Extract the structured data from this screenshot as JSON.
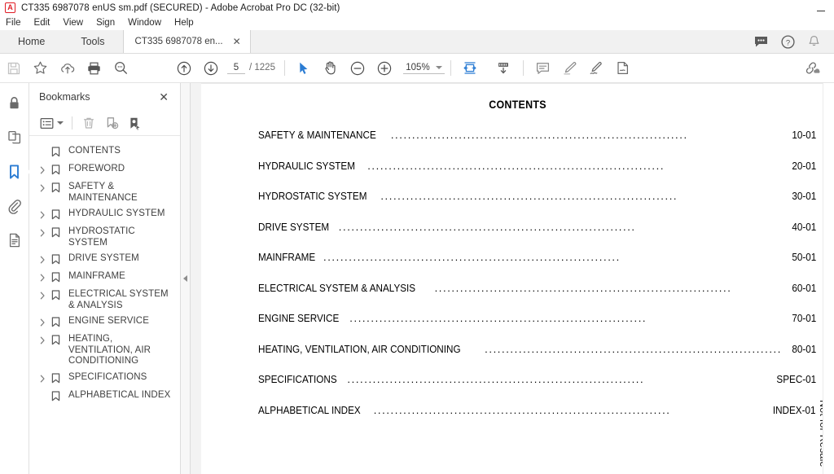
{
  "window": {
    "title": "CT335 6987078 enUS sm.pdf (SECURED) - Adobe Acrobat Pro DC (32-bit)",
    "app_icon": "acrobat-icon",
    "minimize_label": "—"
  },
  "menubar": {
    "items": [
      "File",
      "Edit",
      "View",
      "Sign",
      "Window",
      "Help"
    ]
  },
  "tabbar": {
    "home": "Home",
    "tools": "Tools",
    "document_tab": "CT335 6987078 en...",
    "close_glyph": "✕",
    "right_icons": [
      "comment-bubble-icon",
      "help-circle-icon",
      "bell-icon"
    ]
  },
  "toolbar": {
    "left_icons": [
      "save-icon",
      "star-icon",
      "cloud-upload-icon",
      "print-icon",
      "search-icon"
    ],
    "prev_page_icon": "arrow-up-circle-icon",
    "next_page_icon": "arrow-down-circle-icon",
    "page_number": "5",
    "page_count": "/ 1225",
    "select_tool_icon": "cursor-arrow-icon",
    "hand_tool_icon": "hand-icon",
    "zoom_out_icon": "minus-circle-icon",
    "zoom_in_icon": "plus-circle-icon",
    "zoom_level": "105%",
    "fit_width_icon": "fit-width-icon",
    "page_fit_icon": "scroll-down-icon",
    "comment_icon": "comment-icon",
    "highlight_icon": "highlight-pen-icon",
    "sign_icon": "sign-icon",
    "fill_sign_icon": "fill-and-sign-icon",
    "share_icon": "share-cloud-icon"
  },
  "rail": {
    "items": [
      {
        "name": "security-lock-icon",
        "active": false
      },
      {
        "name": "page-thumbnails-icon",
        "active": false
      },
      {
        "name": "bookmarks-icon",
        "active": true
      },
      {
        "name": "attachments-icon",
        "active": false
      },
      {
        "name": "layers-icon",
        "active": false
      }
    ]
  },
  "bookmarks_panel": {
    "title": "Bookmarks",
    "close_glyph": "✕",
    "tools": [
      "options-list-icon",
      "delete-bookmark-icon",
      "new-bookmark-icon",
      "bookmark-properties-icon"
    ],
    "items": [
      {
        "label": "CONTENTS",
        "expandable": false
      },
      {
        "label": "FOREWORD",
        "expandable": true
      },
      {
        "label": "SAFETY & MAINTENANCE",
        "expandable": true
      },
      {
        "label": "HYDRAULIC SYSTEM",
        "expandable": true
      },
      {
        "label": "HYDROSTATIC SYSTEM",
        "expandable": true
      },
      {
        "label": "DRIVE SYSTEM",
        "expandable": true
      },
      {
        "label": "MAINFRAME",
        "expandable": true
      },
      {
        "label": "ELECTRICAL SYSTEM & ANALYSIS",
        "expandable": true
      },
      {
        "label": "ENGINE SERVICE",
        "expandable": true
      },
      {
        "label": "HEATING, VENTILATION, AIR CONDITIONING",
        "expandable": true
      },
      {
        "label": "SPECIFICATIONS",
        "expandable": true
      },
      {
        "label": "ALPHABETICAL INDEX",
        "expandable": false
      }
    ]
  },
  "document": {
    "heading": "CONTENTS",
    "side_note": "Not for Resale",
    "toc": [
      {
        "name": "SAFETY & MAINTENANCE",
        "page": "10-01"
      },
      {
        "name": "HYDRAULIC SYSTEM",
        "page": "20-01"
      },
      {
        "name": "HYDROSTATIC SYSTEM",
        "page": "30-01"
      },
      {
        "name": "DRIVE SYSTEM",
        "page": "40-01"
      },
      {
        "name": "MAINFRAME",
        "page": "50-01"
      },
      {
        "name": "ELECTRICAL SYSTEM & ANALYSIS",
        "page": "60-01"
      },
      {
        "name": "ENGINE SERVICE",
        "page": "70-01"
      },
      {
        "name": "HEATING, VENTILATION, AIR CONDITIONING",
        "page": "80-01"
      },
      {
        "name": "SPECIFICATIONS",
        "page": "SPEC-01"
      },
      {
        "name": "ALPHABETICAL INDEX",
        "page": "INDEX-01"
      }
    ]
  },
  "colors": {
    "accent_blue": "#2b7cd3",
    "brand_red": "#e01b24",
    "icon_grey": "#5a5a5a",
    "icon_disabled": "#c2c2c2"
  }
}
